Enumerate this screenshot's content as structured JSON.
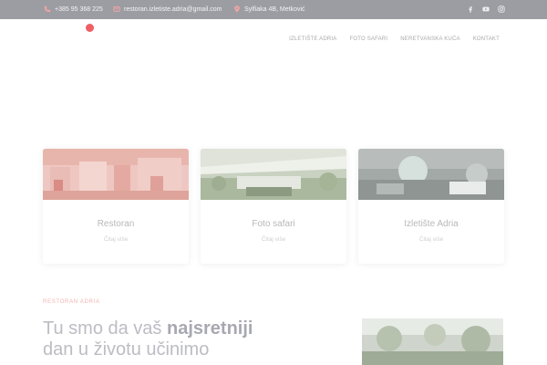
{
  "topbar": {
    "phone": "+385 95 368 225",
    "email": "restoran.izletiste.adria@gmail.com",
    "address": "Sylfiaka 4B, Metković",
    "social": [
      "facebook-icon",
      "youtube-icon",
      "instagram-icon"
    ]
  },
  "nav": {
    "items": [
      {
        "label": "IZLETIŠTE ADRIA"
      },
      {
        "label": "FOTO SAFARI"
      },
      {
        "label": "NERETVANSKA KUĆA"
      },
      {
        "label": "KONTAKT"
      }
    ]
  },
  "cards": [
    {
      "title": "Restoran",
      "more": "Čitaj više"
    },
    {
      "title": "Foto safari",
      "more": "Čitaj više"
    },
    {
      "title": "Izletište Adria",
      "more": "Čitaj više"
    }
  ],
  "intro": {
    "eyebrow": "RESTORAN ADRIA",
    "headline_pre": "Tu smo da vaš ",
    "headline_bold": "najsretniji",
    "headline_post": "dan u životu učinimo"
  },
  "colors": {
    "topbar_bg": "#9c9da3",
    "accent": "#ef5f64"
  }
}
